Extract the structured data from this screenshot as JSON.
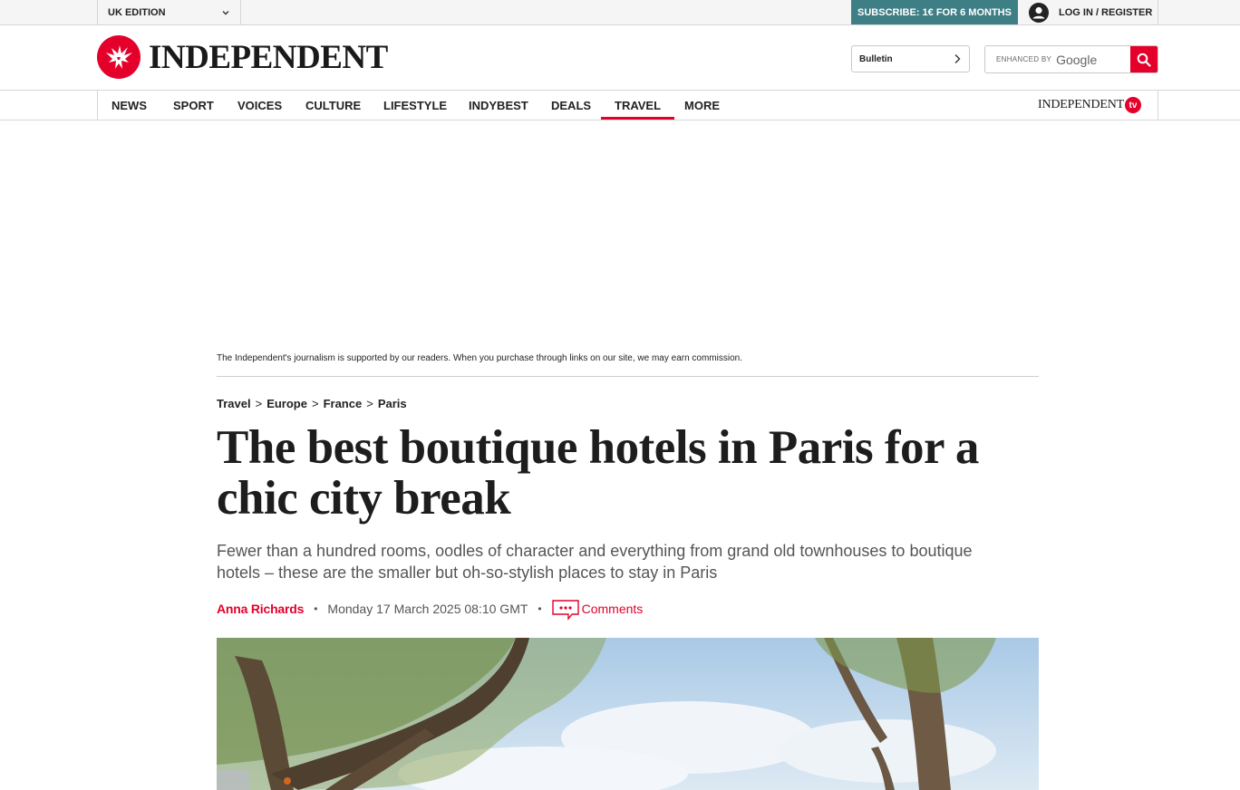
{
  "topbar": {
    "edition_label": "UK EDITION",
    "subscribe_label": "SUBSCRIBE: 1€ FOR 6 MONTHS",
    "login_label": "LOG IN / REGISTER"
  },
  "masthead": {
    "logo_text": "INDEPENDENT",
    "bulletin_label": "Bulletin",
    "search": {
      "enhanced_by": "ENHANCED BY",
      "provider": "Google"
    }
  },
  "nav": {
    "items": [
      {
        "label": "NEWS"
      },
      {
        "label": "SPORT"
      },
      {
        "label": "VOICES"
      },
      {
        "label": "CULTURE"
      },
      {
        "label": "LIFESTYLE"
      },
      {
        "label": "INDYBEST"
      },
      {
        "label": "DEALS"
      },
      {
        "label": "TRAVEL",
        "active": true
      },
      {
        "label": "MORE"
      }
    ],
    "tv_logo_text": "INDEPENDENT",
    "tv_badge": "tv"
  },
  "article": {
    "disclaimer": "The Independent's journalism is supported by our readers. When you purchase through links on our site, we may earn commission.",
    "breadcrumb": [
      "Travel",
      "Europe",
      "France",
      "Paris"
    ],
    "breadcrumb_separator": ">",
    "headline": "The best boutique hotels in Paris for a chic city break",
    "standfirst": "Fewer than a hundred rooms, oodles of character and everything from grand old townhouses to boutique hotels – these are the smaller but oh-so-stylish places to stay in Paris",
    "author": "Anna Richards",
    "date": "Monday 17 March 2025 08:10 GMT",
    "comments_label": "Comments",
    "separator": "•"
  },
  "colors": {
    "brand_red": "#e4002b",
    "subscribe_teal": "#3e7f86"
  },
  "icons": {
    "edition_chevron": "chevron-down-icon",
    "login": "user-avatar-icon",
    "logo": "eagle-logo-icon",
    "bulletin_chevron": "chevron-right-icon",
    "search": "search-icon",
    "comments": "comment-bubble-icon"
  }
}
